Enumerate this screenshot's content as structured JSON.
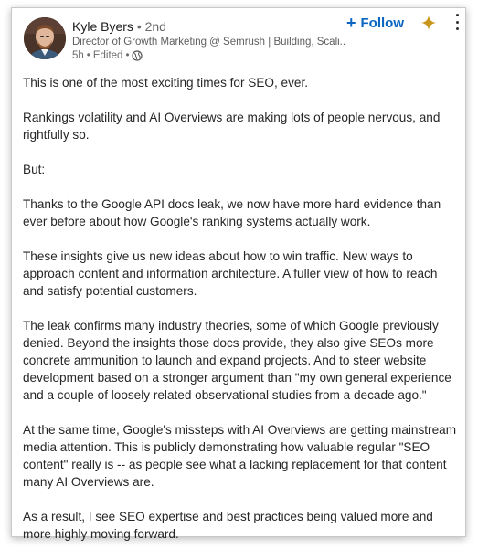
{
  "author": {
    "name": "Kyle Byers",
    "separator": "•",
    "degree": "2nd",
    "headline": "Director of Growth Marketing @ Semrush | Building, Scali...",
    "time": "5h",
    "edited": "Edited",
    "visibility_icon": "globe-icon"
  },
  "actions": {
    "follow_icon": "plus-icon",
    "follow_label": "Follow",
    "spark_icon": "sparkle-icon",
    "more_icon": "more-vertical-icon"
  },
  "colors": {
    "accent": "#0a66c2",
    "spark": "#c9961a"
  },
  "post": {
    "paragraphs": [
      "This is one of the most exciting times for SEO, ever.",
      "Rankings volatility and AI Overviews are making lots of people nervous, and rightfully so.",
      "But:",
      "Thanks to the Google API docs leak, we now have more hard evidence than ever before about how Google's ranking systems actually work.",
      "These insights give us new ideas about how to win traffic. New ways to approach content and information architecture. A fuller view of how to reach and satisfy potential customers.",
      "The leak confirms many industry theories, some of which Google previously denied. Beyond the insights those docs provide, they also give SEOs more concrete ammunition to launch and expand projects. And to steer website development based on a stronger argument than \"my own general experience and a couple of loosely related observational studies from a decade ago.\"",
      "At the same time, Google's missteps with AI Overviews are getting mainstream media attention. This is publicly demonstrating how valuable regular \"SEO content\" really is -- as people see what a lacking replacement for that content many AI Overviews are.",
      "As a result, I see SEO expertise and best practices being valued more and more highly moving forward."
    ]
  }
}
